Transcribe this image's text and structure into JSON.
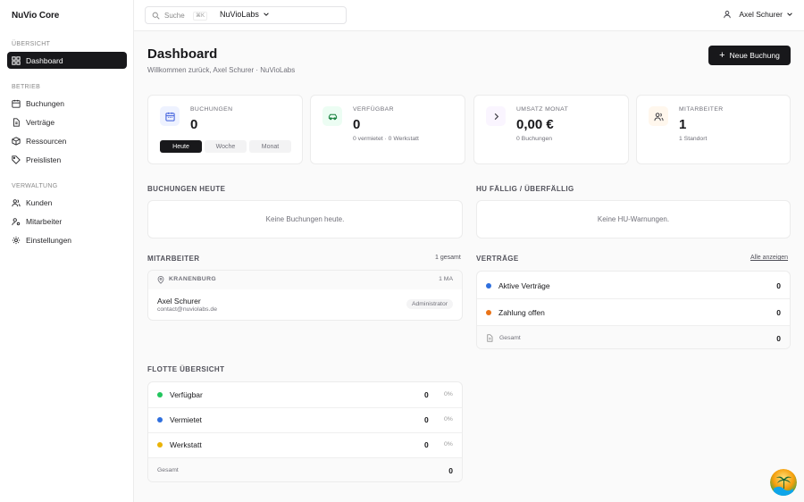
{
  "app": {
    "name": "NuVio Core"
  },
  "sidebar": {
    "sections": [
      {
        "title": "ÜBERSICHT",
        "items": [
          {
            "label": "Dashboard",
            "icon": "layout-grid-icon",
            "active": true
          }
        ]
      },
      {
        "title": "BETRIEB",
        "items": [
          {
            "label": "Buchungen",
            "icon": "calendar-icon"
          },
          {
            "label": "Verträge",
            "icon": "file-icon"
          },
          {
            "label": "Ressourcen",
            "icon": "box-icon"
          },
          {
            "label": "Preislisten",
            "icon": "tag-icon"
          }
        ]
      },
      {
        "title": "VERWALTUNG",
        "items": [
          {
            "label": "Kunden",
            "icon": "users-icon"
          },
          {
            "label": "Mitarbeiter",
            "icon": "user-cog-icon"
          },
          {
            "label": "Einstellungen",
            "icon": "gear-icon"
          }
        ]
      }
    ]
  },
  "topbar": {
    "search_placeholder": "Suche",
    "search_shortcut": "⌘K",
    "org": "NuVioLabs",
    "user": "Axel Schurer"
  },
  "header": {
    "title": "Dashboard",
    "subtitle": "Willkommen zurück, Axel Schurer · NuVioLabs",
    "new_booking": "Neue Buchung"
  },
  "stats": [
    {
      "label": "BUCHUNGEN",
      "value": "0",
      "icon": "calendar-icon",
      "tint": "#eef2ff",
      "color": "#3b5bdb"
    },
    {
      "label": "VERFÜGBAR",
      "value": "0",
      "sub": "0 vermietet · 0 Werkstatt",
      "icon": "car-icon",
      "tint": "#ecfdf3",
      "color": "#15803d"
    },
    {
      "label": "UMSATZ MONAT",
      "value": "0,00 €",
      "sub": "0 Buchungen",
      "icon": "chevron-right-icon",
      "tint": "#faf5ff",
      "color": "#6b21a8"
    },
    {
      "label": "MITARBEITER",
      "value": "1",
      "sub": "1 Standort",
      "icon": "users-icon",
      "tint": "#fff7ed",
      "color": "#c2410c"
    }
  ],
  "period_tabs": [
    {
      "label": "Heute",
      "active": true
    },
    {
      "label": "Woche"
    },
    {
      "label": "Monat"
    }
  ],
  "bookings_today": {
    "title": "BUCHUNGEN HEUTE",
    "empty": "Keine Buchungen heute."
  },
  "hu": {
    "title": "HU FÄLLIG / ÜBERFÄLLIG",
    "empty": "Keine HU-Warnungen."
  },
  "staff": {
    "title": "MITARBEITER",
    "count": "1 gesamt",
    "location": "KRANENBURG",
    "location_count": "1 MA",
    "member": {
      "name": "Axel Schurer",
      "email": "contact@nuviolabs.de",
      "role": "Administrator"
    }
  },
  "contracts": {
    "title": "VERTRÄGE",
    "link": "Alle anzeigen",
    "rows": [
      {
        "label": "Aktive Verträge",
        "value": "0",
        "color": "#2f6fde"
      },
      {
        "label": "Zahlung offen",
        "value": "0",
        "color": "#ea7317"
      }
    ],
    "total_label": "Gesamt",
    "total": "0"
  },
  "fleet": {
    "title": "FLOTTE ÜBERSICHT",
    "rows": [
      {
        "label": "Verfügbar",
        "value": "0",
        "pct": "0%",
        "color": "#22c55e"
      },
      {
        "label": "Vermietet",
        "value": "0",
        "pct": "0%",
        "color": "#2f6fde"
      },
      {
        "label": "Werkstatt",
        "value": "0",
        "pct": "0%",
        "color": "#eab308"
      }
    ],
    "total_label": "Gesamt",
    "total": "0"
  }
}
